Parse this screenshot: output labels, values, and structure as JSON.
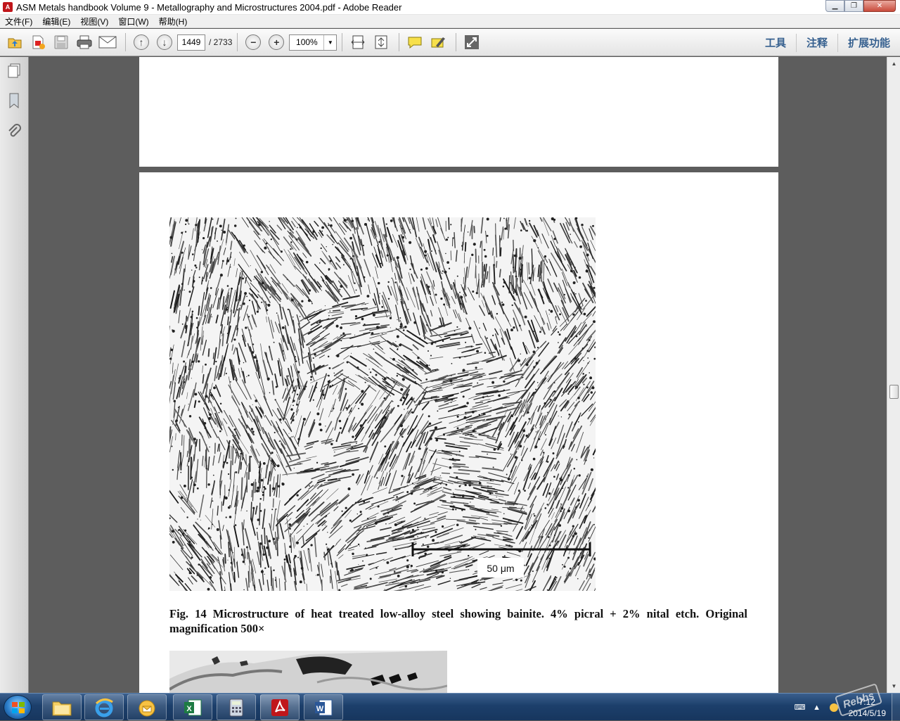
{
  "window": {
    "title": "ASM Metals handbook Volume 9 - Metallography and Microstructures 2004.pdf - Adobe Reader",
    "minimize_symbol": "▁",
    "maximize_symbol": "❐",
    "close_symbol": "✕"
  },
  "menu": [
    "文件(F)",
    "编辑(E)",
    "视图(V)",
    "窗口(W)",
    "帮助(H)"
  ],
  "toolbar": {
    "current_page": "1449",
    "page_total": "/ 2733",
    "zoom": "100%",
    "zoom_out_symbol": "−",
    "zoom_in_symbol": "+",
    "prev_page_symbol": "↑",
    "next_page_symbol": "↓",
    "right_panes": [
      "工具",
      "注释",
      "扩展功能"
    ]
  },
  "document": {
    "caption": "Fig. 14 Microstructure of heat treated low-alloy steel showing bainite. 4% picral + 2% nital etch. Original magnification 500×",
    "scale_bar_label": "50 μm"
  },
  "taskbar": {
    "time": "7:12",
    "date": "2014/5/19",
    "watermark": "Rebbs"
  },
  "colors": {
    "pane_link": "#36608f",
    "doc_background": "#5d5d5d",
    "taskbar": "#1c3f6b"
  }
}
